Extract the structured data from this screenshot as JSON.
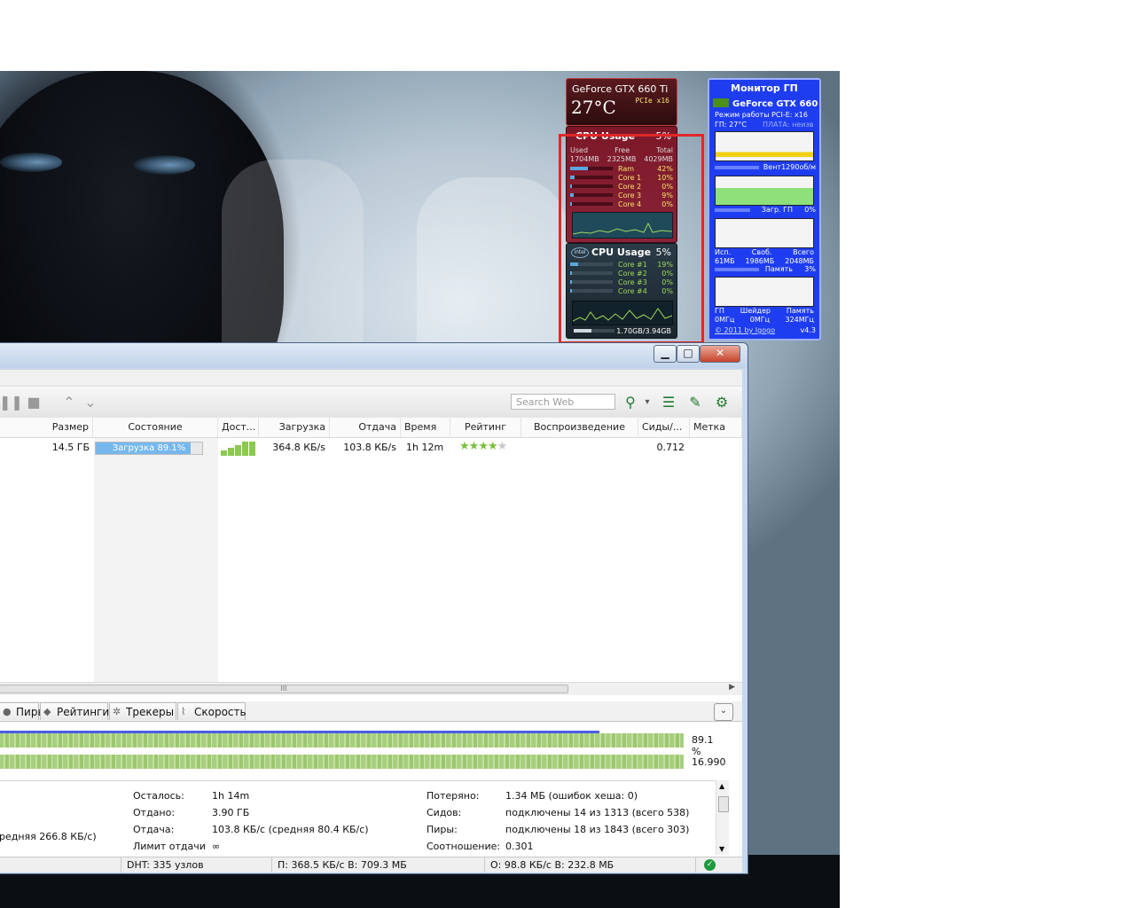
{
  "gadgets": {
    "gpu_temp": {
      "name": "GeForce GTX 660 Ti",
      "temp": "27°C",
      "pcie": "PCIe x16"
    },
    "cpu_meter_1": {
      "title": "CPU Usage",
      "percent": "5%",
      "mem_headers": [
        "Used",
        "Free",
        "Total"
      ],
      "mem_values": [
        "1704MB",
        "2325MB",
        "4029MB"
      ],
      "rows": [
        {
          "label": "Ram",
          "value": "42%",
          "fill": 0.42
        },
        {
          "label": "Core 1",
          "value": "10%",
          "fill": 0.1
        },
        {
          "label": "Core 2",
          "value": "0%",
          "fill": 0.0
        },
        {
          "label": "Core 3",
          "value": "9%",
          "fill": 0.09
        },
        {
          "label": "Core 4",
          "value": "0%",
          "fill": 0.0
        }
      ]
    },
    "cpu_meter_2": {
      "title": "CPU Usage",
      "percent": "5%",
      "logo": "intel",
      "rows": [
        {
          "label": "Core #1",
          "value": "19%",
          "fill": 0.19
        },
        {
          "label": "Core #2",
          "value": "0%",
          "fill": 0.0
        },
        {
          "label": "Core #3",
          "value": "0%",
          "fill": 0.0
        },
        {
          "label": "Core #4",
          "value": "0%",
          "fill": 0.0
        }
      ],
      "memory": "1.70GB/3.94GB"
    },
    "gpu_monitor": {
      "title": "Монитор ГП",
      "gpu_name": "GeForce GTX 660",
      "mode": "Режим работы PCI-E: x16",
      "gpu_temp": "ГП: 27°C",
      "board": "ПЛАТА: неизв",
      "fan": "Вент1290об/м",
      "load": "Загр. ГП",
      "load_value": "0%",
      "mem_headers": [
        "Исп.",
        "Своб.",
        "Всего"
      ],
      "mem_values": [
        "61МБ",
        "1986МБ",
        "2048МБ"
      ],
      "memory_label": "Память",
      "memory_value": "3%",
      "clock_headers": [
        "ГП",
        "Шейдер",
        "Память"
      ],
      "clock_values": [
        "0МГц",
        "0МГц",
        "324МГц"
      ],
      "credit": "© 2011 by Igogo",
      "version": "v4.3"
    }
  },
  "window": {
    "controls": {
      "minimize": "▁",
      "maximize": "□",
      "close": "✕"
    },
    "toolbar": {
      "search_placeholder": "Search Web",
      "icons": [
        "pause-icon",
        "stop-icon",
        "move-up-icon",
        "move-down-icon",
        "search-icon",
        "dropdown-icon",
        "list-icon",
        "remote-icon",
        "settings-icon"
      ]
    },
    "columns": [
      "Размер",
      "Состояние",
      "Дост...",
      "Загрузка",
      "Отдача",
      "Время",
      "Рейтинг",
      "Воспроизведение",
      "Сиды/...",
      "Метка"
    ],
    "torrent": {
      "size": "14.5 ГБ",
      "status": "Загрузка 89.1%",
      "progress": 0.891,
      "download": "364.8 КБ/s",
      "upload": "103.8 КБ/s",
      "eta": "1h 12m",
      "rating": 4,
      "ratio": "0.712"
    },
    "tabs": [
      "Пиры",
      "Рейтинги",
      "Трекеры",
      "Скорость"
    ],
    "pieces": {
      "downloaded": "89.1 %",
      "availability": "16.990",
      "progress": 0.891
    },
    "info": {
      "avg_download_tail": "редняя 266.8 КБ/с)",
      "left_label": "Осталось:",
      "left_value": "1h 14m",
      "sent_label": "Отдано:",
      "sent_value": "3.90 ГБ",
      "upload_label": "Отдача:",
      "upload_value": "103.8 КБ/с (средняя 80.4 КБ/с)",
      "limit_label": "Лимит отдачи",
      "limit_value": "∞",
      "wasted_label": "Потеряно:",
      "wasted_value": "1.34 МБ (ошибок хеша: 0)",
      "seeds_label": "Сидов:",
      "seeds_value": "подключены 14 из 1313 (всего 538)",
      "peers_label": "Пиры:",
      "peers_value": "подключены 18 из 1843 (всего 303)",
      "ratio_label": "Соотношение:",
      "ratio_value": "0.301"
    },
    "statusbar": {
      "dht": "DHT: 335 узлов",
      "down": "П: 368.5 КБ/с В: 709.3 МБ",
      "up": "О: 98.8 КБ/с В: 232.8 МБ"
    }
  }
}
